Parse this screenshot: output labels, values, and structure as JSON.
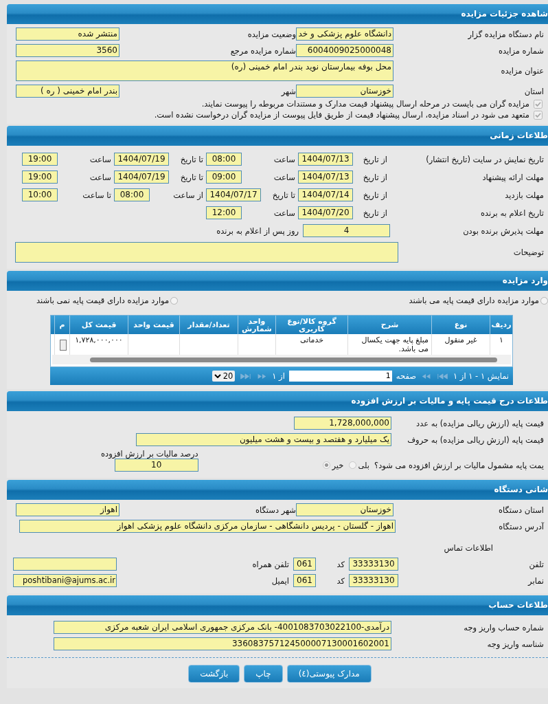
{
  "details": {
    "title": "شاهده جزئیات مزایده",
    "fields": [
      {
        "label": "نام دستگاه مزایده گزار",
        "value": "دانشگاه علوم پزشکی و خد"
      },
      {
        "label": "وضعیت مزایده",
        "value": "منتشر شده"
      },
      {
        "label": "شماره مزایده",
        "value": "6004009025000048"
      },
      {
        "label": "شماره مزایده مرجع",
        "value": "3560"
      }
    ],
    "subject": {
      "label": "عنوان مزایده",
      "value": "محل بوفه بیمارستان نوید بندر امام خمینی (ره)"
    },
    "location": [
      {
        "label": "استان",
        "value": "خوزستان"
      },
      {
        "label": "شهر",
        "value": "بندر امام خمینی ( ره )"
      }
    ],
    "checks": [
      {
        "label": "مزایده گران می بایست در مرحله ارسال پیشنهاد قیمت مدارک و مستندات مربوطه را پیوست نمایند.",
        "checked": true
      },
      {
        "label": "متعهد می شود در اسناد مزایده، ارسال پیشنهاد قیمت از طریق فایل پیوست از مزایده گران درخواست نشده است.",
        "checked": true
      }
    ]
  },
  "timing": {
    "title": "طلاعات زمانی",
    "rows": [
      {
        "label": "تاریخ نمایش در سایت (تاریخ انتشار)",
        "parts": [
          {
            "prefix": "از تاریخ",
            "value": "1404/07/13",
            "kind": "date"
          },
          {
            "prefix": "ساعت",
            "value": "08:00",
            "kind": "time"
          },
          {
            "prefix": "تا تاریخ",
            "value": "1404/07/19",
            "kind": "date"
          },
          {
            "prefix": "ساعت",
            "value": "19:00",
            "kind": "time"
          }
        ]
      },
      {
        "label": "مهلت ارائه پیشنهاد",
        "parts": [
          {
            "prefix": "از تاریخ",
            "value": "1404/07/13",
            "kind": "date"
          },
          {
            "prefix": "ساعت",
            "value": "09:00",
            "kind": "time"
          },
          {
            "prefix": "تا تاریخ",
            "value": "1404/07/19",
            "kind": "date"
          },
          {
            "prefix": "ساعت",
            "value": "19:00",
            "kind": "time"
          }
        ]
      },
      {
        "label": "مهلت بازدید",
        "parts": [
          {
            "prefix": "از تاریخ",
            "value": "1404/07/14",
            "kind": "date"
          },
          {
            "prefix": "تا تاریخ",
            "value": "1404/07/17",
            "kind": "date"
          },
          {
            "prefix": "از ساعت",
            "value": "08:00",
            "kind": "time"
          },
          {
            "prefix": "تا ساعت",
            "value": "10:00",
            "kind": "time"
          }
        ]
      },
      {
        "label": "تاریخ اعلام به برنده",
        "parts": [
          {
            "prefix": "از تاریخ",
            "value": "1404/07/20",
            "kind": "date"
          },
          {
            "prefix": "ساعت",
            "value": "12:00",
            "kind": "time"
          }
        ]
      }
    ],
    "acceptance": {
      "label": "مهلت پذیرش برنده بودن",
      "value": "4",
      "suffix": "روز پس از اعلام به برنده"
    },
    "notes": {
      "label": "توضیحات"
    }
  },
  "items": {
    "title": "وارد مزایده",
    "options": [
      {
        "label": "موارد مزایده دارای قیمت پایه می باشند",
        "selected": false
      },
      {
        "label": "موارد مزایده دارای قیمت پایه نمی باشند",
        "selected": false
      }
    ],
    "table": {
      "columns": [
        "ردیف",
        "نوع",
        "شرح",
        "گروه کالا/نوع کاربری",
        "واحد شمارش",
        "تعداد/مقدار",
        "قیمت واحد",
        "قیمت کل",
        "م"
      ],
      "rows": [
        [
          "۱",
          "غیر منقول",
          "مبلغ پایه جهت یکسال می باشد.",
          "خدماتی",
          "",
          "",
          "",
          "۱,۷۲۸,۰۰۰,۰۰۰",
          ""
        ]
      ]
    },
    "pager": {
      "summary": "نمایش ۱ - ۱ از ۱",
      "page_label": "صفحه",
      "page": "1",
      "of": "از ۱",
      "page_size": "20"
    }
  },
  "price": {
    "title": "طلاعات درج قیمت پایه و مالیات بر ارزش افزوده",
    "fields": [
      {
        "label": "قیمت پایه (ارزش ریالی مزایده) به عدد",
        "value": "1,728,000,000"
      },
      {
        "label": "قیمت پایه (ارزش ریالی مزایده) به حروف",
        "value": "یک میلیارد و هفتصد و بیست و هشت میلیون"
      }
    ],
    "vat": {
      "label": "یمت پایه مشمول مالیات بر ارزش افزوده می شود؟",
      "options": [
        {
          "label": "بلی",
          "selected": false
        },
        {
          "label": "خیر",
          "selected": true
        }
      ],
      "rate_label": "درصد مالیات بر ارزش افزوده",
      "rate": "10"
    }
  },
  "device": {
    "title": "شانی دستگاه",
    "fields": [
      {
        "label": "استان دستگاه",
        "value": "خوزستان"
      },
      {
        "label": "شهر دستگاه",
        "value": "اهواز"
      }
    ],
    "address": {
      "label": "آدرس دستگاه",
      "value": "اهواز - گلستان - پردیس دانشگاهی - سازمان مرکزی دانشگاه علوم پزشکی اهواز"
    },
    "contact_title": "اطلاعات تماس",
    "contacts": [
      {
        "label": "تلفن",
        "value": "33333130",
        "code_label": "کد",
        "code": "061",
        "other_label": "تلفن همراه"
      },
      {
        "label": "نمابر",
        "value": "33333130",
        "code_label": "کد",
        "code": "061",
        "other_label": "ایمیل",
        "other_value": "poshtibani@ajums.ac.ir"
      }
    ]
  },
  "account": {
    "title": "طلاعات حساب",
    "fields": [
      {
        "label": "شماره حساب واریز وجه",
        "value": "درآمدی-4001083703022100- بانک مرکزی جمهوری اسلامی ایران شعبه مرکزی"
      },
      {
        "label": "شناسه واریز وجه",
        "value": "336083757124500007130001602001"
      }
    ]
  },
  "buttons": [
    "مدارک پیوستی(٤)",
    "چاپ",
    "بازگشت"
  ]
}
